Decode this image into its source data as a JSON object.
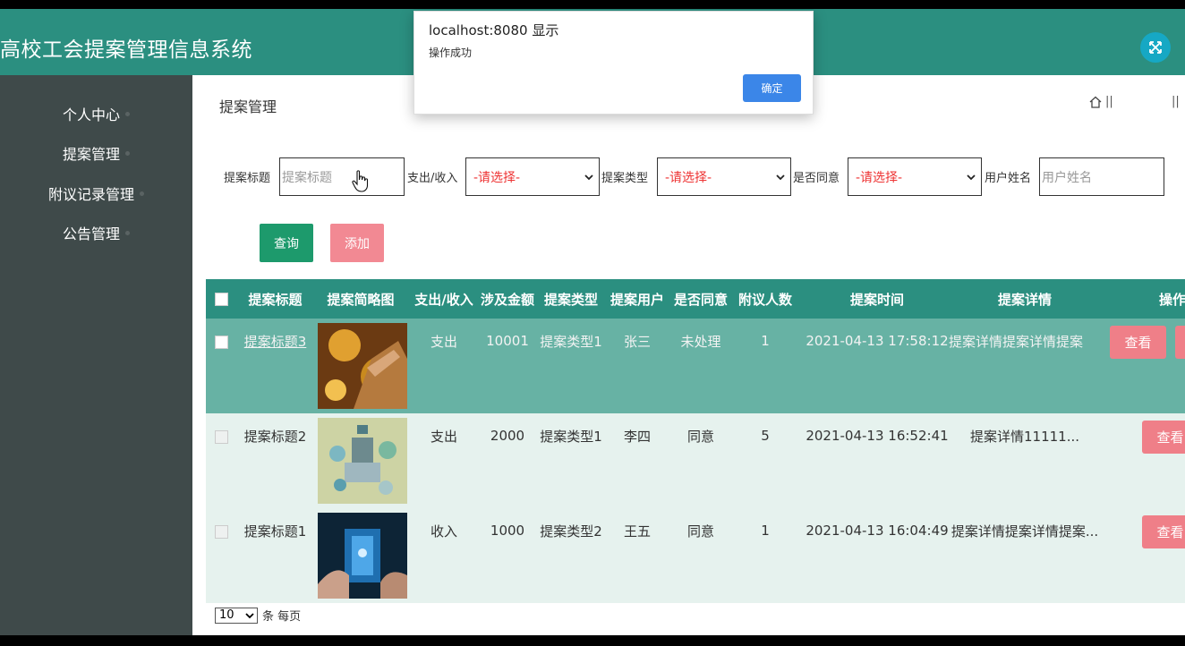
{
  "app": {
    "title": "高校工会提案管理信息系统"
  },
  "sidebar": {
    "items": [
      {
        "label": "个人中心"
      },
      {
        "label": "提案管理"
      },
      {
        "label": "附议记录管理"
      },
      {
        "label": "公告管理"
      }
    ]
  },
  "page": {
    "title": "提案管理",
    "breadcrumb_sep": "||",
    "breadcrumb_sep2": "||"
  },
  "filters": {
    "title_label": "提案标题",
    "title_placeholder": "提案标题",
    "income_label": "支出/收入",
    "income_value": "-请选择-",
    "type_label": "提案类型",
    "type_value": "-请选择-",
    "agree_label": "是否同意",
    "agree_value": "-请选择-",
    "user_label": "用户姓名",
    "user_placeholder": "用户姓名"
  },
  "buttons": {
    "query": "查询",
    "add": "添加"
  },
  "table": {
    "headers": [
      "提案标题",
      "提案简略图",
      "支出/收入",
      "涉及金额",
      "提案类型",
      "提案用户",
      "是否同意",
      "附议人数",
      "提案时间",
      "提案详情",
      "操作"
    ],
    "rows": [
      {
        "title": "提案标题3",
        "income": "支出",
        "amount": "10001",
        "type": "提案类型1",
        "user": "张三",
        "agree": "未处理",
        "count": "1",
        "time": "2021-04-13 17:58:12",
        "detail": "提案详情提案详情提案",
        "action": "查看"
      },
      {
        "title": "提案标题2",
        "income": "支出",
        "amount": "2000",
        "type": "提案类型1",
        "user": "李四",
        "agree": "同意",
        "count": "5",
        "time": "2021-04-13 16:52:41",
        "detail": "提案详情11111...",
        "action": "查看"
      },
      {
        "title": "提案标题1",
        "income": "收入",
        "amount": "1000",
        "type": "提案类型2",
        "user": "王五",
        "agree": "同意",
        "count": "1",
        "time": "2021-04-13 16:04:49",
        "detail": "提案详情提案详情提案...",
        "action": "查看"
      }
    ]
  },
  "pager": {
    "page_size": "10",
    "suffix": "条 每页"
  },
  "dialog": {
    "title": "localhost:8080 显示",
    "message": "操作成功",
    "ok": "确定"
  },
  "colors": {
    "header": "#2b8f80",
    "sidebar": "#3f4a4a",
    "selected_row": "#67b2a4",
    "view_button": "#ef7f88",
    "dialog_ok": "#3b86e8"
  }
}
